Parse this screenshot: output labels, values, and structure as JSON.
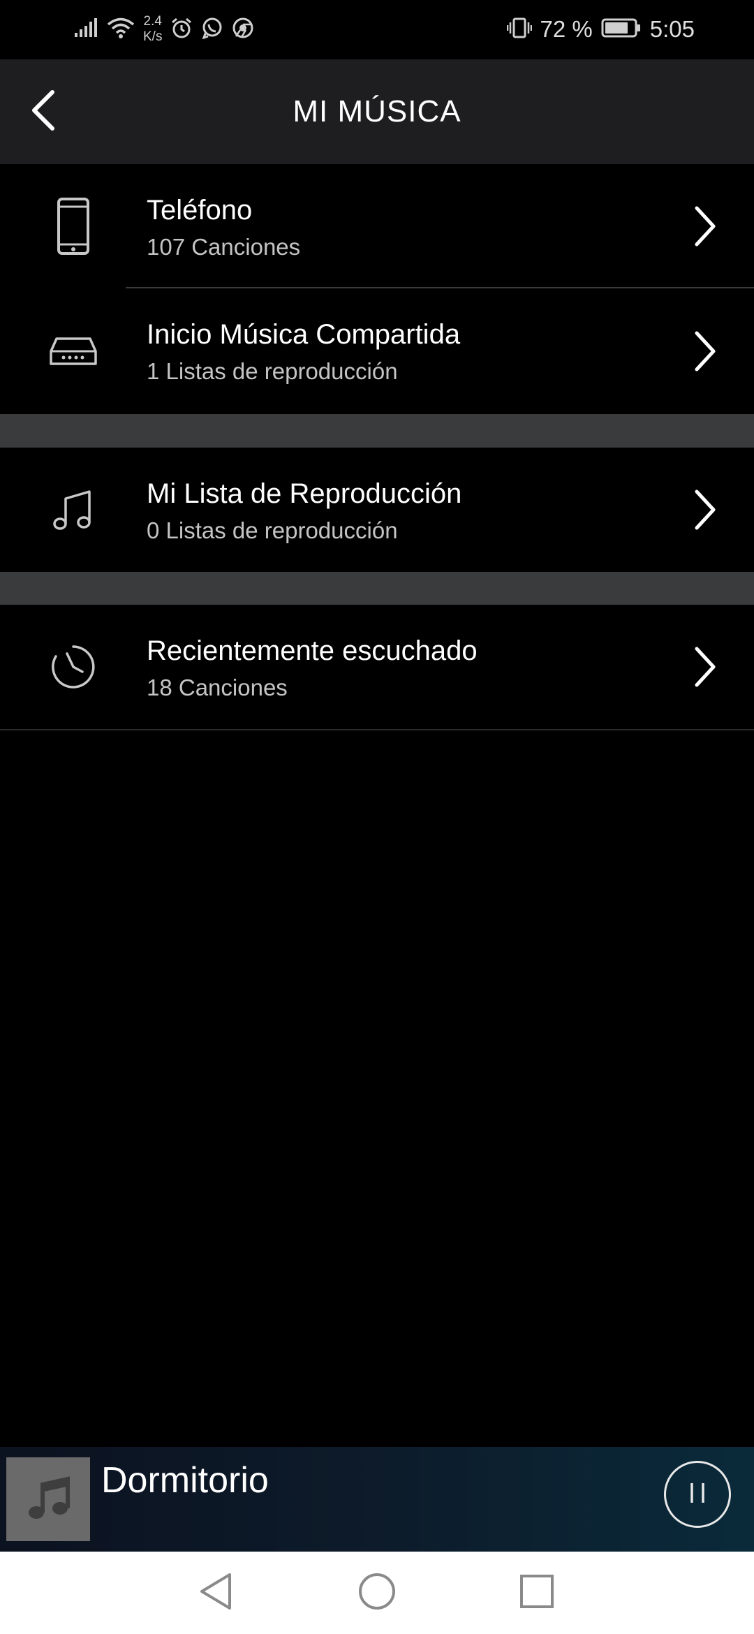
{
  "status_bar": {
    "net_speed_value": "2.4",
    "net_speed_unit": "K/s",
    "battery_percent": "72 %",
    "time": "5:05"
  },
  "header": {
    "title": "MI MÚSICA",
    "back_icon": "chevron-left-icon"
  },
  "items": [
    {
      "title": "Teléfono",
      "subtitle": "107  Canciones",
      "icon": "phone-icon"
    },
    {
      "title": "Inicio Música Compartida",
      "subtitle": "1 Listas de reproducción",
      "icon": "media-server-icon"
    },
    {
      "title": "Mi Lista de Reproducción",
      "subtitle": "0 Listas de reproducción",
      "icon": "music-note-icon"
    },
    {
      "title": "Recientemente escuchado",
      "subtitle": "18  Canciones",
      "icon": "clock-icon"
    }
  ],
  "player": {
    "title": "Dormitorio",
    "state_icon": "pause-icon"
  },
  "colors": {
    "background": "#000000",
    "header": "#1e1e20",
    "section_gap": "#3a3b3d",
    "subtitle": "#c4c4c4",
    "nav_bar": "#ffffff"
  }
}
